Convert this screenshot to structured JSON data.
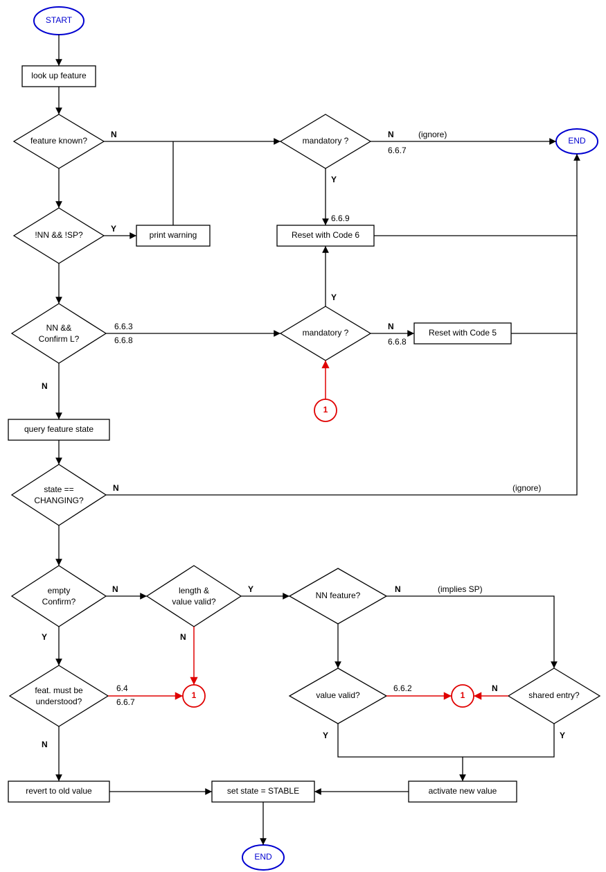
{
  "terminators": {
    "start": "START",
    "end_top": "END",
    "end_bottom": "END"
  },
  "processes": {
    "look_up": "look up feature",
    "print_warning": "print warning",
    "reset6": "Reset with Code 6",
    "reset5": "Reset with Code 5",
    "query_state": "query feature state",
    "revert": "revert to old value",
    "set_stable": "set state = STABLE",
    "activate": "activate new value"
  },
  "decisions": {
    "feature_known": "feature known?",
    "mandatory_top": "mandatory ?",
    "nn_sp": "!NN  && !SP?",
    "nn_confirm_l1": "NN  &&",
    "nn_confirm_l2": "Confirm L?",
    "mandatory_mid": "mandatory ?",
    "state_changing_l1": "state ==",
    "state_changing_l2": "CHANGING?",
    "empty_confirm_l1": "empty",
    "empty_confirm_l2": "Confirm?",
    "len_val_l1": "length &",
    "len_val_l2": "value valid?",
    "nn_feature": "NN feature?",
    "feat_und_l1": "feat. must  be",
    "feat_und_l2": "understood?",
    "value_valid": "value valid?",
    "shared_entry": "shared entry?"
  },
  "connectors": {
    "c1": "1",
    "c2": "1",
    "c3": "1"
  },
  "labels": {
    "Y": "Y",
    "N": "N",
    "ignore": "(ignore)",
    "implies_sp": "(implies SP)",
    "r667": "6.6.7",
    "r669": "6.6.9",
    "r663": "6.6.3",
    "r668a": "6.6.8",
    "r668b": "6.6.8",
    "r64": "6.4",
    "r667b": "6.6.7",
    "r662": "6.6.2"
  }
}
